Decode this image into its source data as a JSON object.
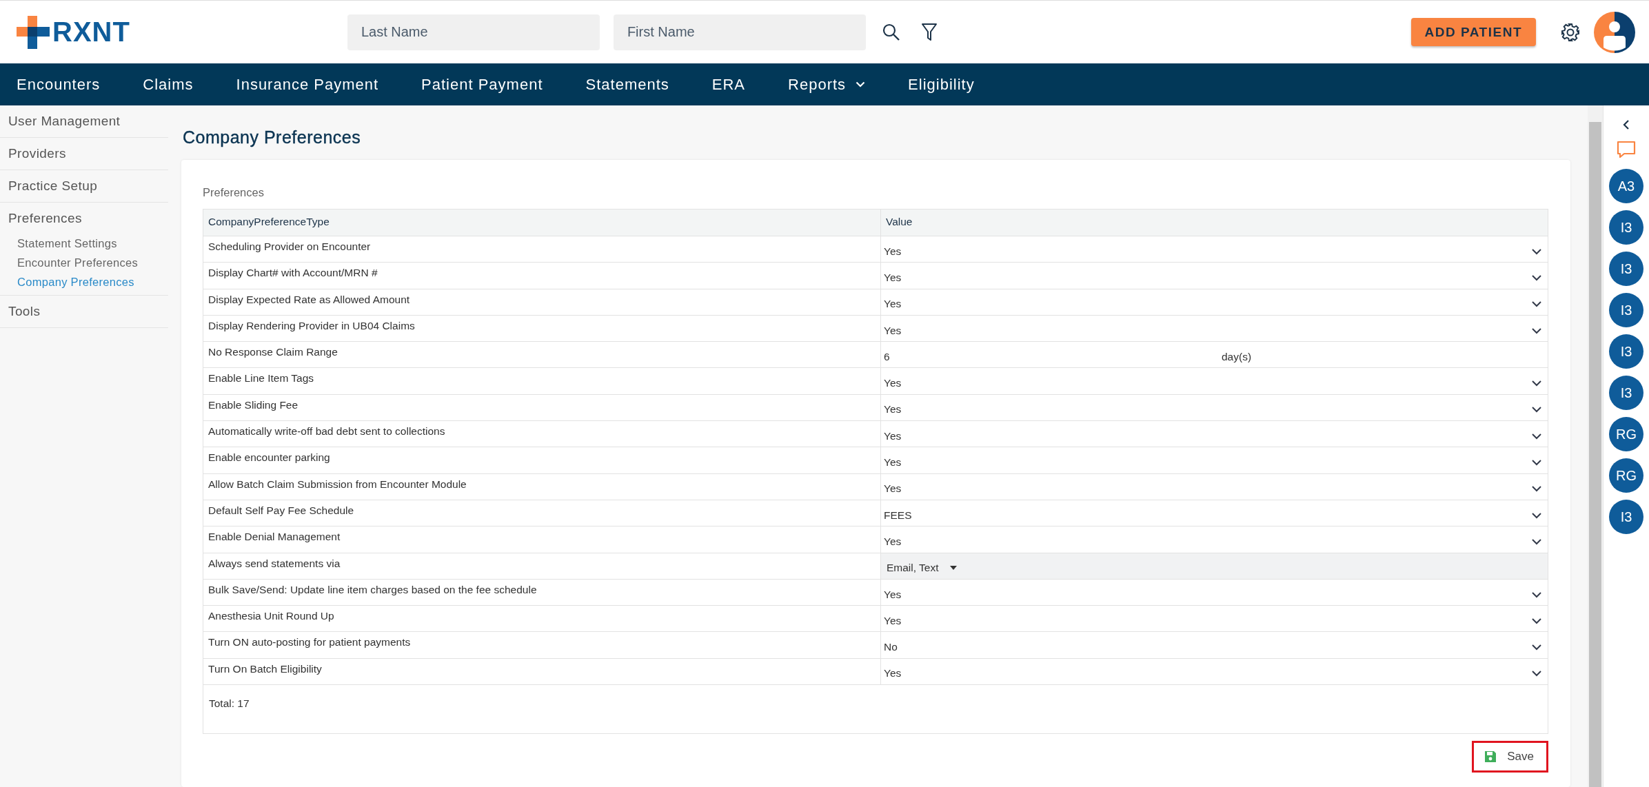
{
  "header": {
    "logo": "RXNT",
    "last_name": {
      "placeholder": "Last Name"
    },
    "first_name": {
      "placeholder": "First Name"
    },
    "add_patient": "ADD PATIENT"
  },
  "nav": [
    {
      "label": "Encounters",
      "kind": "link"
    },
    {
      "label": "Claims",
      "kind": "link"
    },
    {
      "label": "Insurance Payment",
      "kind": "link"
    },
    {
      "label": "Patient Payment",
      "kind": "link"
    },
    {
      "label": "Statements",
      "kind": "link"
    },
    {
      "label": "ERA",
      "kind": "link"
    },
    {
      "label": "Reports",
      "kind": "dropdown"
    },
    {
      "label": "Eligibility",
      "kind": "link"
    }
  ],
  "sidebar": {
    "items": [
      {
        "label": "User Management",
        "selected": false
      },
      {
        "label": "Providers",
        "selected": false
      },
      {
        "label": "Practice Setup",
        "selected": false
      },
      {
        "label": "Preferences",
        "selected": false,
        "children": [
          {
            "label": "Statement Settings",
            "selected": false
          },
          {
            "label": "Encounter Preferences",
            "selected": false
          },
          {
            "label": "Company Preferences",
            "selected": true
          }
        ]
      },
      {
        "label": "Tools",
        "selected": false
      }
    ]
  },
  "page": {
    "title": "Company Preferences",
    "section": "Preferences",
    "columns": [
      "CompanyPreferenceType",
      "Value"
    ],
    "rows": [
      {
        "name": "Scheduling Provider on Encounter",
        "kind": "select",
        "value": "Yes"
      },
      {
        "name": "Display Chart# with Account/MRN #",
        "kind": "select",
        "value": "Yes"
      },
      {
        "name": "Display Expected Rate as Allowed Amount",
        "kind": "select",
        "value": "Yes"
      },
      {
        "name": "Display Rendering Provider in UB04 Claims",
        "kind": "select",
        "value": "Yes"
      },
      {
        "name": "No Response Claim Range",
        "kind": "number",
        "value": "6",
        "unit": "day(s)"
      },
      {
        "name": "Enable Line Item Tags",
        "kind": "select",
        "value": "Yes"
      },
      {
        "name": "Enable Sliding Fee",
        "kind": "select",
        "value": "Yes"
      },
      {
        "name": "Automatically write-off bad debt sent to collections",
        "kind": "select",
        "value": "Yes"
      },
      {
        "name": "Enable encounter parking",
        "kind": "select",
        "value": "Yes"
      },
      {
        "name": "Allow Batch Claim Submission from Encounter Module",
        "kind": "select",
        "value": "Yes"
      },
      {
        "name": "Default Self Pay Fee Schedule",
        "kind": "select",
        "value": "FEES"
      },
      {
        "name": "Enable Denial Management",
        "kind": "select",
        "value": "Yes"
      },
      {
        "name": "Always send statements via",
        "kind": "multiselect",
        "value": "Email, Text"
      },
      {
        "name": "Bulk Save/Send: Update line item charges based on the fee schedule",
        "kind": "select",
        "value": "Yes"
      },
      {
        "name": "Anesthesia Unit Round Up",
        "kind": "select",
        "value": "Yes"
      },
      {
        "name": "Turn ON auto-posting for patient payments",
        "kind": "select",
        "value": "No"
      },
      {
        "name": "Turn On Batch Eligibility",
        "kind": "select",
        "value": "Yes"
      }
    ],
    "total": "Total: 17",
    "save": "Save"
  },
  "rail": {
    "avatars": [
      "A3",
      "I3",
      "I3",
      "I3",
      "I3",
      "I3",
      "RG",
      "RG",
      "I3"
    ]
  }
}
